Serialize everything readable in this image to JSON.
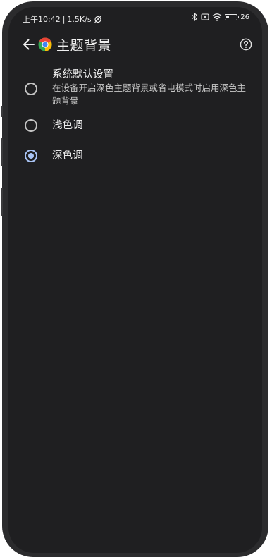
{
  "status_bar": {
    "time": "上午10:42",
    "separator": "|",
    "net_speed": "1.5K/s",
    "battery_text": "26",
    "battery_level": 0.26
  },
  "header": {
    "title": "主题背景",
    "back_icon": "arrow-left-icon",
    "app_icon": "chrome-logo-icon",
    "help_icon": "help-circle-icon"
  },
  "theme_options": [
    {
      "label": "系统默认设置",
      "description": "在设备开启深色主题背景或省电模式时启用深色主题背景",
      "selected": false
    },
    {
      "label": "浅色调",
      "selected": false
    },
    {
      "label": "深色调",
      "selected": true
    }
  ],
  "colors": {
    "background": "#1f1f21",
    "text_primary": "#ececec",
    "text_secondary": "#c9c9c9",
    "accent": "#a9c4f5",
    "radio_unchecked": "#c4c4c4"
  }
}
